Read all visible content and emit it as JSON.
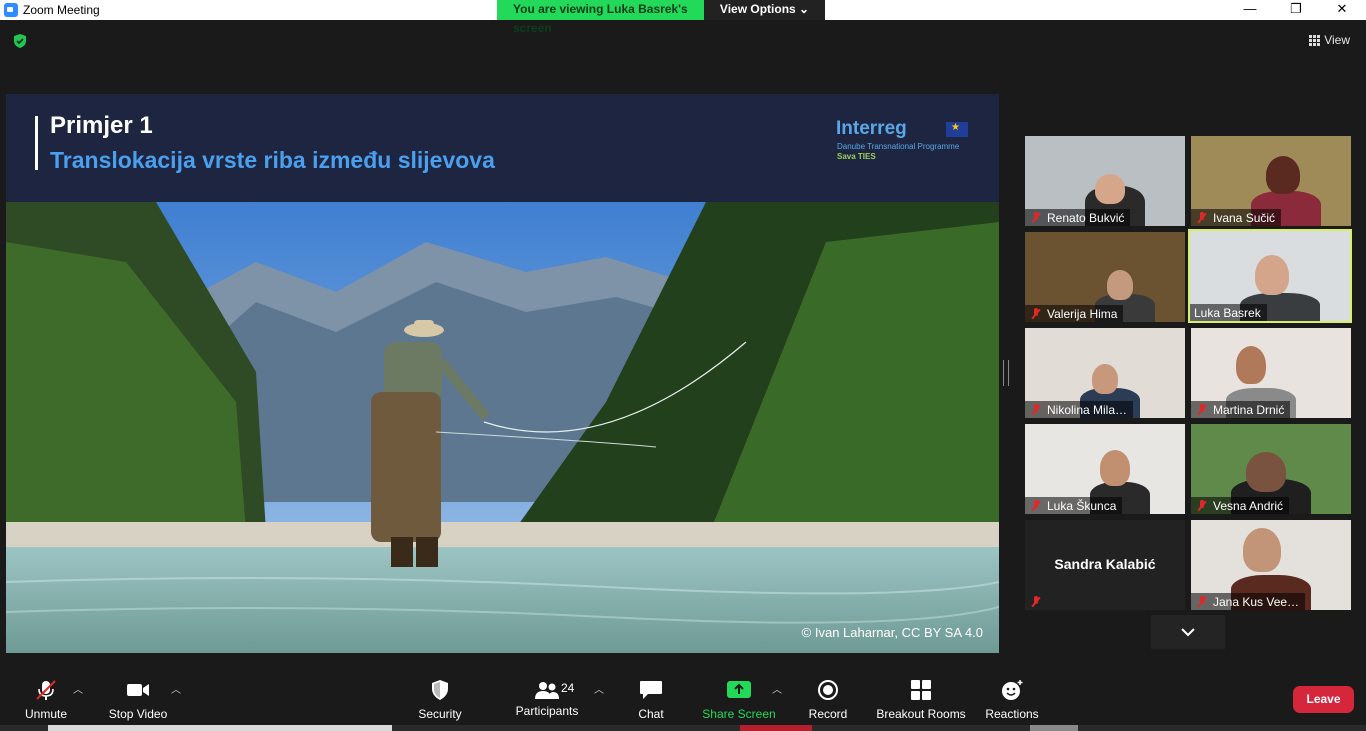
{
  "window": {
    "title": "Zoom Meeting",
    "banner_text": "You are viewing Luka Basrek's screen",
    "view_options": "View Options ⌄",
    "minimize": "—",
    "maximize": "❐",
    "close": "✕"
  },
  "topbar": {
    "view_label": "View"
  },
  "slide": {
    "title": "Primjer 1",
    "subtitle": "Translokacija vrste riba između slijevova",
    "logo_brand": "Interreg",
    "logo_line2": "Danube Transnational Programme",
    "logo_line3": "Sava TIES",
    "credit": "© Ivan Laharnar, CC BY SA 4.0"
  },
  "participants": [
    {
      "name": "Renato Bukvić",
      "muted": true
    },
    {
      "name": "Ivana Sučić",
      "muted": true
    },
    {
      "name": "Valerija Hima",
      "muted": true
    },
    {
      "name": "Luka Basrek",
      "muted": false,
      "active": true
    },
    {
      "name": "Nikolina Mila…",
      "muted": true
    },
    {
      "name": "Martina Drnić",
      "muted": true
    },
    {
      "name": "Luka Škunca",
      "muted": true
    },
    {
      "name": "Vesna Andrić",
      "muted": true
    },
    {
      "name": "Sandra Kalabić",
      "muted": true,
      "video_off": true
    },
    {
      "name": "Jana Kus Vee…",
      "muted": true
    }
  ],
  "toolbar": {
    "unmute": "Unmute",
    "stop_video": "Stop Video",
    "security": "Security",
    "participants": "Participants",
    "participants_count": "24",
    "chat": "Chat",
    "share_screen": "Share Screen",
    "record": "Record",
    "breakout": "Breakout Rooms",
    "reactions": "Reactions",
    "leave": "Leave"
  },
  "colors": {
    "accent_green": "#23d959",
    "leave_red": "#d6263c",
    "slide_blue": "#4aa0ee",
    "active_speaker": "#d7ef6b"
  }
}
